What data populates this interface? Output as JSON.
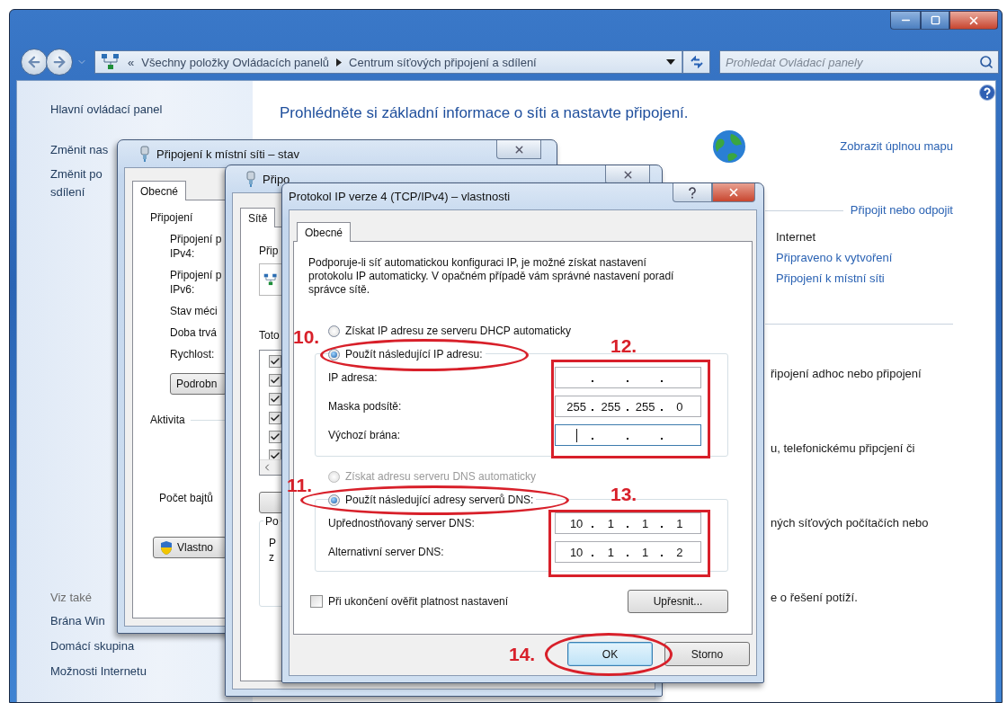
{
  "window": {
    "address": {
      "overflow_mark": "«",
      "segments": [
        "Všechny položky Ovládacích panelů",
        "Centrum síťových připojení a sdílení"
      ]
    },
    "search": {
      "placeholder": "Prohledat Ovládací panely"
    }
  },
  "sidebar": {
    "links": [
      {
        "lines": [
          "Hlavní ovládací panel"
        ]
      },
      {
        "lines": [
          "Změnit nas"
        ]
      },
      {
        "lines": [
          "Změnit po",
          "sdílení"
        ]
      }
    ],
    "see_also_title": "Viz také",
    "see_also": [
      "Brána Win",
      "Domácí skupina",
      "Možnosti Internetu"
    ]
  },
  "content": {
    "heading": "Prohlédněte si základní informace o síti a nastavte připojení.",
    "map_link": "Zobrazit úplnou mapu",
    "connect_title": "Připojit nebo odpojit",
    "access_label": "Internet",
    "links": [
      "Připraveno k vytvoření",
      "Připojení k místní síti"
    ],
    "tasks": [
      "řipojení adhoc nebo připojení",
      "u, telefonickému připcjení či",
      "ných síťových počítačích nebo",
      "e o řešení potíží."
    ]
  },
  "status_dialog": {
    "title": "Připojení k místní síti – stav",
    "tabs": [
      {
        "label": "Obecné",
        "selected": true
      }
    ],
    "section": "Připojení",
    "rows": [
      {
        "lines": [
          "Připojení p",
          "IPv4:"
        ]
      },
      {
        "lines": [
          "Připojení p",
          "IPv6:"
        ]
      },
      {
        "lines": [
          "Stav méci"
        ]
      },
      {
        "lines": [
          "Doba trvá"
        ]
      },
      {
        "lines": [
          "Rychlost:"
        ]
      }
    ],
    "details_button": "Podrobn",
    "activity": "Aktivita",
    "bytes_label": "Počet bajtů",
    "properties_button": "Vlastno"
  },
  "properties_dialog": {
    "title": "Připo",
    "tabs": [
      {
        "label": "Sítě",
        "selected": true
      }
    ],
    "connect_label": "Přip",
    "items_label": "Toto",
    "items": [
      {
        "checked": true
      },
      {
        "checked": true
      },
      {
        "checked": true
      },
      {
        "checked": true
      },
      {
        "checked": true
      },
      {
        "checked": true
      }
    ],
    "group_title": "Po",
    "group_lines": [
      "P",
      "z"
    ]
  },
  "ipv4_dialog": {
    "title": "Protokol IP verze 4 (TCP/IPv4) – vlastnosti",
    "tabs": [
      {
        "label": "Obecné",
        "selected": true
      }
    ],
    "description": "Podporuje-li síť automatickou konfiguraci IP, je možné získat nastavení protokolu IP automaticky. V opačném případě vám správné nastavení poradí správce sítě.",
    "ip_options": [
      {
        "label": "Získat IP adresu ze serveru DHCP automaticky",
        "selected": false,
        "disabled": false
      },
      {
        "label": "Použít následující IP adresu:",
        "selected": true,
        "disabled": false
      }
    ],
    "ip_fields": [
      {
        "label": "IP adresa:",
        "focused": false
      },
      {
        "label": "Maska podsítě:",
        "octets": [
          "255",
          "255",
          "255",
          "0"
        ],
        "focused": false
      },
      {
        "label": "Výchozí brána:",
        "focused": true
      }
    ],
    "dns_options": [
      {
        "label": "Získat adresu serveru DNS automaticky",
        "selected": false,
        "disabled": true
      },
      {
        "label": "Použít následující adresy serverů DNS:",
        "selected": true,
        "disabled": false
      }
    ],
    "dns_fields": [
      {
        "label": "Upřednostňovaný server DNS:",
        "octets": [
          "10",
          "1",
          "1",
          "1"
        ],
        "focused": false
      },
      {
        "label": "Alternativní server DNS:",
        "octets": [
          "10",
          "1",
          "1",
          "2"
        ],
        "focused": false
      }
    ],
    "validate": {
      "label": "Při ukončení ověřit platnost nastavení",
      "checked": false
    },
    "advanced_button": "Upřesnit...",
    "buttons": [
      {
        "label": "OK",
        "default": true
      },
      {
        "label": "Storno",
        "default": false
      }
    ]
  },
  "annotations": [
    {
      "number": "10.",
      "kind": "ellipse"
    },
    {
      "number": "12.",
      "kind": "frame"
    },
    {
      "number": "11.",
      "kind": "ellipse"
    },
    {
      "number": "13.",
      "kind": "frame"
    },
    {
      "number": "14.",
      "kind": "ellipse"
    }
  ]
}
